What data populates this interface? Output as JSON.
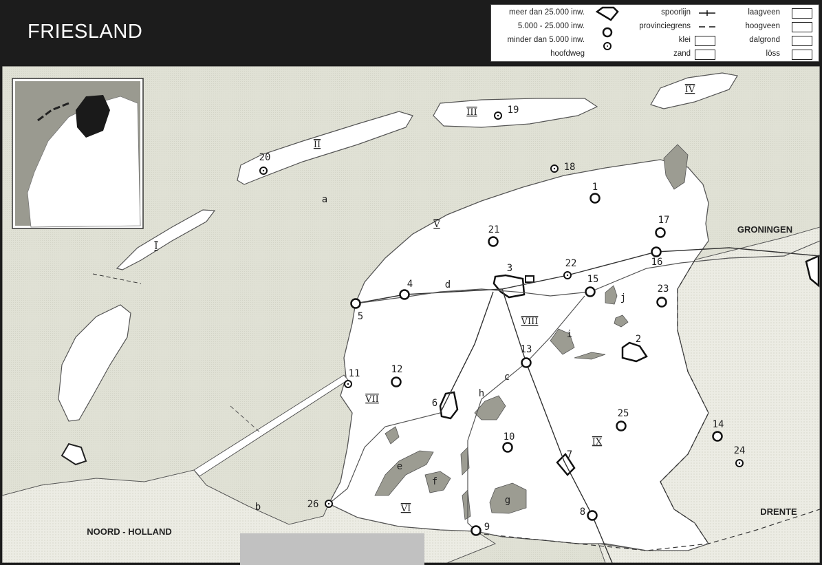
{
  "title": "FRIESLAND",
  "legend": {
    "settlements": [
      "meer dan 25.000 inw.",
      "5.000 - 25.000 inw.",
      "minder dan 5.000 inw.",
      "hoofdweg"
    ],
    "lines_and_soils": [
      "spoorlijn",
      "provinciegrens",
      "klei",
      "zand"
    ],
    "soils": [
      "laagveen",
      "hoogveen",
      "dalgrond",
      "löss"
    ]
  },
  "map": {
    "places": [
      "1",
      "2",
      "3",
      "4",
      "5",
      "6",
      "7",
      "8",
      "9",
      "10",
      "11",
      "12",
      "13",
      "14",
      "15",
      "16",
      "17",
      "18",
      "19",
      "20",
      "21",
      "22",
      "23",
      "24",
      "25",
      "26"
    ],
    "letters": [
      "a",
      "b",
      "c",
      "d",
      "e",
      "f",
      "g",
      "h",
      "i",
      "j"
    ],
    "regions": [
      "I",
      "II",
      "III",
      "IV",
      "V",
      "VI",
      "VII",
      "VIII",
      "IX"
    ],
    "provinces": [
      "GRONINGEN",
      "DRENTE",
      "NOORD - HOLLAND"
    ]
  },
  "colors": {
    "sea": "#e2e3d8",
    "land": "#ffffff",
    "lake": "#9c9c92",
    "header": "#1c1c1c"
  }
}
